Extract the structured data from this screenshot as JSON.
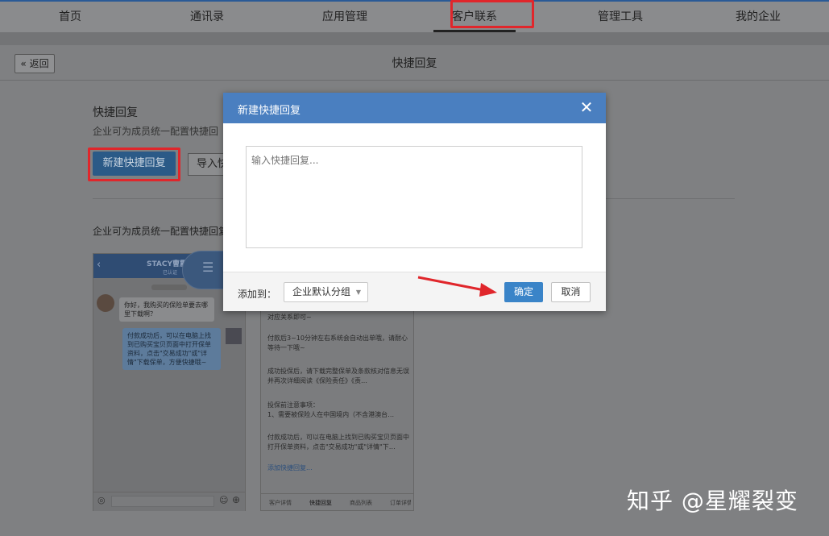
{
  "nav": {
    "items": [
      "首页",
      "通讯录",
      "应用管理",
      "客户联系",
      "管理工具",
      "我的企业"
    ],
    "active_index": 3
  },
  "header": {
    "back_label": "« 返回",
    "title": "快捷回复"
  },
  "section": {
    "title": "快捷回复",
    "description": "企业可为成员统一配置快捷回",
    "new_button": "新建快捷回复",
    "import_button": "导入快",
    "description2": "企业可为成员统一配置快捷回复"
  },
  "preview_left": {
    "contact_name": "STACY曹震",
    "contact_sub": "已认证",
    "msg_customer": "你好，我购买的保险单要去哪里下载啊？",
    "msg_staff": "付款成功后，可以在电脑上找到已购买宝贝页面中打开保单资料，点击\"交易成功\"或\"详情\"下载保单，方便快捷哦~"
  },
  "preview_right": {
    "lines": [
      "对应关系即可~",
      "付款后3~10分钟左右系统会自动出单哦，请耐心等待一下哦~",
      "成功投保后，请下载完整保单及条款核对信息无误并再次详细阅读《保险责任》《责…",
      "投保前注意事项：\n1、需要被保险人在中国境内（不含港澳台…",
      "付款成功后，可以在电脑上找到已购买宝贝页面中打开保单资料，点击\"交易成功\"或\"详情\"下…"
    ],
    "add_link": "添加快捷回复...",
    "tabs": [
      "客户详情",
      "快捷回复",
      "商品列表",
      "订单详情"
    ]
  },
  "modal": {
    "title": "新建快捷回复",
    "close_symbol": "✕",
    "textarea_placeholder": "输入快捷回复...",
    "add_to_label": "添加到：",
    "group_selected": "企业默认分组",
    "caret": "▼",
    "ok_label": "确定",
    "cancel_label": "取消"
  },
  "watermark": "知乎 @星耀裂变",
  "colors": {
    "accent": "#4a7fc0",
    "highlight": "#e0262b",
    "primary_button": "#3a84c8"
  }
}
